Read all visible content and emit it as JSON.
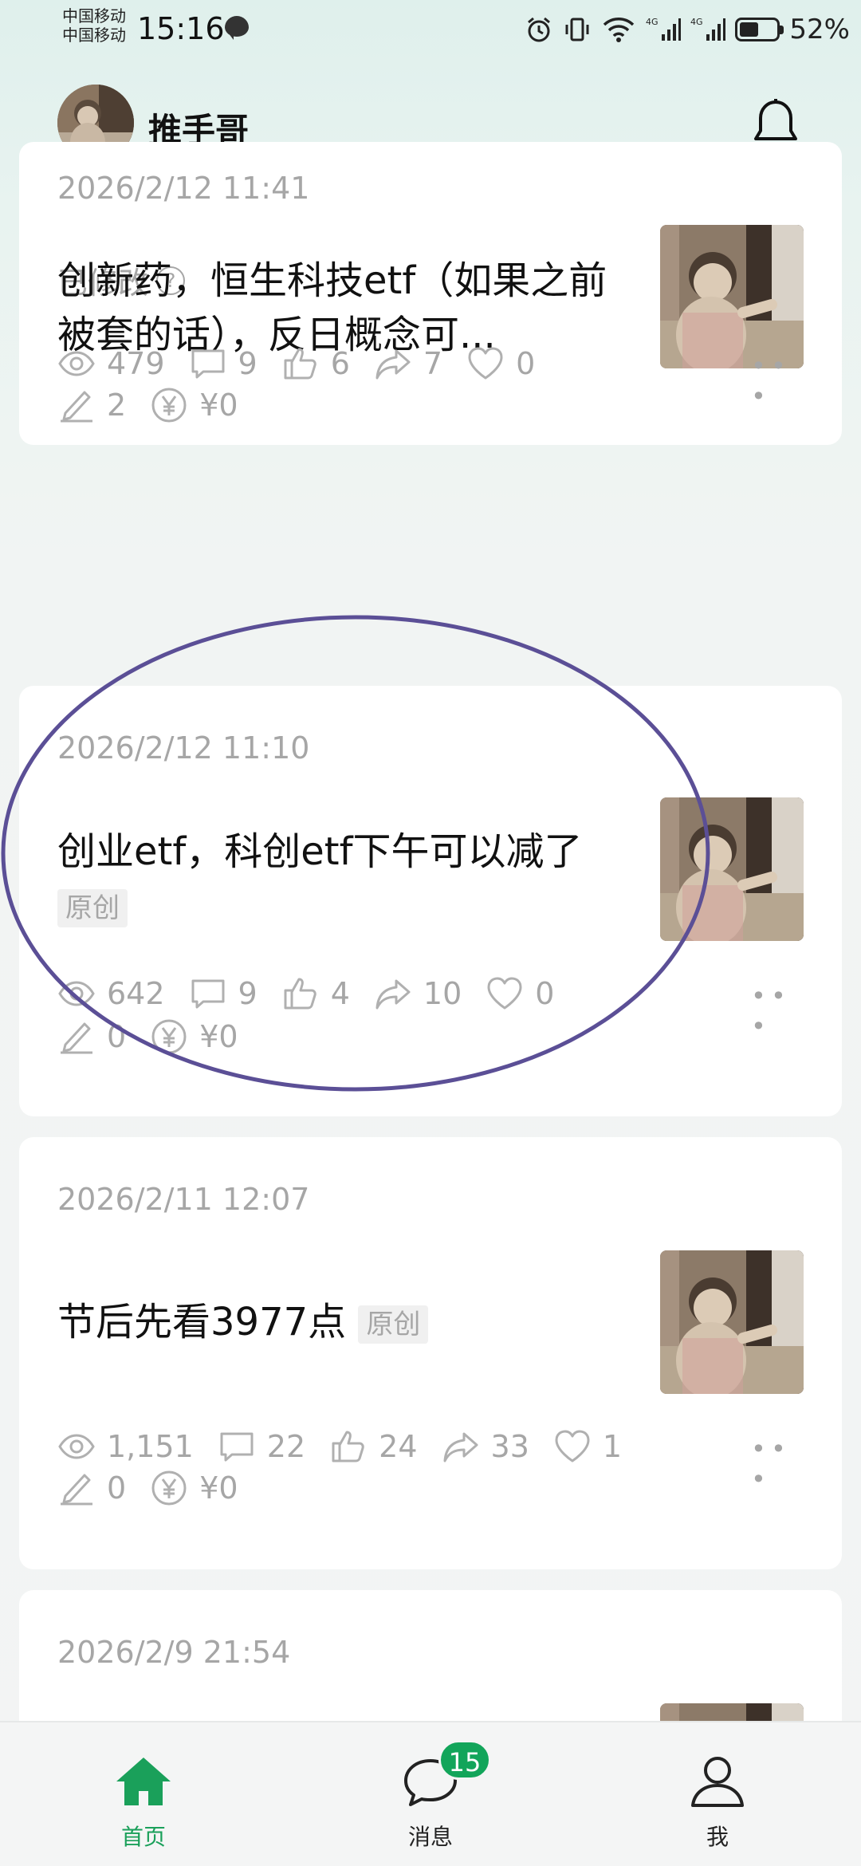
{
  "status_bar": {
    "carrier_1": "中国移动",
    "carrier_2": "中国移动",
    "time": "15:16",
    "battery": "52%",
    "battery_level": 0.52
  },
  "header": {
    "user_name": "推手哥"
  },
  "posts": [
    {
      "date": "2026/2/12 11:41",
      "modified_label": "已修改",
      "title": "创新药，恒生科技etf（如果之前被套的话），反日概念可...",
      "stats": {
        "views": "479",
        "comments": "9",
        "likes": "6",
        "shares": "7",
        "favorites": "0",
        "edits": "2",
        "rewards": "¥0"
      }
    },
    {
      "date": "2026/2/12 11:10",
      "title": "创业etf，科创etf下午可以减了",
      "badge": "原创",
      "stats": {
        "views": "642",
        "comments": "9",
        "likes": "4",
        "shares": "10",
        "favorites": "0",
        "edits": "0",
        "rewards": "¥0"
      }
    },
    {
      "date": "2026/2/11 12:07",
      "title": "节后先看3977点",
      "badge": "原创",
      "stats": {
        "views": "1,151",
        "comments": "22",
        "likes": "24",
        "shares": "33",
        "favorites": "1",
        "edits": "0",
        "rewards": "¥0"
      }
    },
    {
      "date": "2026/2/9 21:54"
    }
  ],
  "bottom_nav": {
    "home": "首页",
    "messages": "消息",
    "messages_badge": "15",
    "me": "我"
  },
  "colors": {
    "accent": "#1aa05a",
    "annotation": "#5b4f96",
    "muted": "#a6a6a6"
  }
}
